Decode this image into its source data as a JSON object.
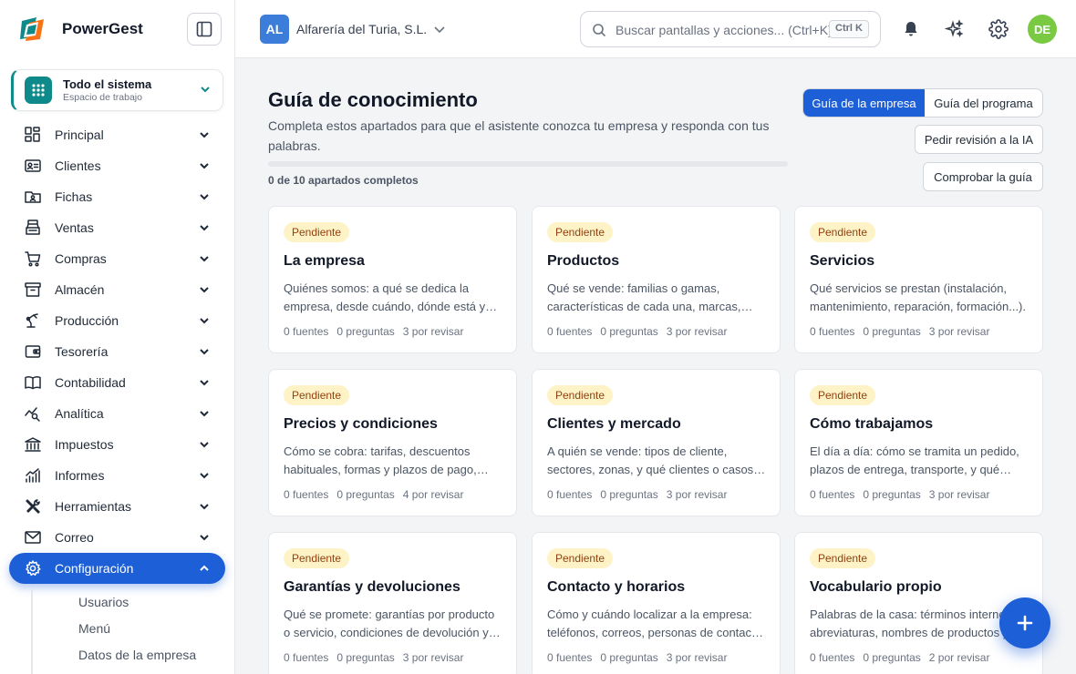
{
  "brand": {
    "name": "PowerGest",
    "accent": "#1d5fd6"
  },
  "workspace": {
    "title": "Todo el sistema",
    "subtitle": "Espacio de trabajo"
  },
  "nav": {
    "items": [
      {
        "label": "Principal",
        "icon": "grid-icon"
      },
      {
        "label": "Clientes",
        "icon": "id-card-icon"
      },
      {
        "label": "Fichas",
        "icon": "folder-user-icon"
      },
      {
        "label": "Ventas",
        "icon": "cash-register-icon"
      },
      {
        "label": "Compras",
        "icon": "cart-icon"
      },
      {
        "label": "Almacén",
        "icon": "archive-icon"
      },
      {
        "label": "Producción",
        "icon": "robot-arm-icon"
      },
      {
        "label": "Tesorería",
        "icon": "wallet-icon"
      },
      {
        "label": "Contabilidad",
        "icon": "book-icon"
      },
      {
        "label": "Analítica",
        "icon": "chart-search-icon"
      },
      {
        "label": "Impuestos",
        "icon": "bank-icon"
      },
      {
        "label": "Informes",
        "icon": "bars-icon"
      },
      {
        "label": "Herramientas",
        "icon": "tools-icon"
      },
      {
        "label": "Correo",
        "icon": "mail-icon"
      },
      {
        "label": "Configuración",
        "icon": "gear-icon",
        "active": true
      }
    ],
    "subitems": [
      "Usuarios",
      "Menú",
      "Datos de la empresa"
    ]
  },
  "header": {
    "company_initials": "AL",
    "company_name": "Alfarería del Turia, S.L.",
    "search_placeholder": "Buscar pantallas y acciones... (Ctrl+K)",
    "search_shortcut": "Ctrl K",
    "avatar_initials": "DE"
  },
  "main": {
    "title": "Guía de conocimiento",
    "subtitle": "Completa estos apartados para que el asistente conozca tu empresa y responda con tus palabras.",
    "progress": {
      "completed": 0,
      "total": 10,
      "label": "0 de 10 apartados completos"
    },
    "tabs": [
      {
        "label": "Guía de la empresa",
        "active": true
      },
      {
        "label": "Guía del programa",
        "active": false
      }
    ],
    "actions": {
      "review": "Pedir revisión a la IA",
      "check": "Comprobar la guía"
    },
    "cards": [
      {
        "status": "Pendiente",
        "title": "La empresa",
        "desc": "Quiénes somos: a qué se dedica la empresa, desde cuándo, dónde está y qué la hace distinta.",
        "sources": "0 fuentes",
        "questions": "0 preguntas",
        "review": "3 por revisar"
      },
      {
        "status": "Pendiente",
        "title": "Productos",
        "desc": "Qué se vende: familias o gamas, características de cada una, marcas, formatos.",
        "sources": "0 fuentes",
        "questions": "0 preguntas",
        "review": "3 por revisar"
      },
      {
        "status": "Pendiente",
        "title": "Servicios",
        "desc": "Qué servicios se prestan (instalación, mantenimiento, reparación, formación...).",
        "sources": "0 fuentes",
        "questions": "0 preguntas",
        "review": "3 por revisar"
      },
      {
        "status": "Pendiente",
        "title": "Precios y condiciones",
        "desc": "Cómo se cobra: tarifas, descuentos habituales, formas y plazos de pago, portes.",
        "sources": "0 fuentes",
        "questions": "0 preguntas",
        "review": "4 por revisar"
      },
      {
        "status": "Pendiente",
        "title": "Clientes y mercado",
        "desc": "A quién se vende: tipos de cliente, sectores, zonas, y qué clientes o casos son habituales.",
        "sources": "0 fuentes",
        "questions": "0 preguntas",
        "review": "3 por revisar"
      },
      {
        "status": "Pendiente",
        "title": "Cómo trabajamos",
        "desc": "El día a día: cómo se tramita un pedido, plazos de entrega, transporte, y qué pasos se siguen.",
        "sources": "0 fuentes",
        "questions": "0 preguntas",
        "review": "3 por revisar"
      },
      {
        "status": "Pendiente",
        "title": "Garantías y devoluciones",
        "desc": "Qué se promete: garantías por producto o servicio, condiciones de devolución y plazos.",
        "sources": "0 fuentes",
        "questions": "0 preguntas",
        "review": "3 por revisar"
      },
      {
        "status": "Pendiente",
        "title": "Contacto y horarios",
        "desc": "Cómo y cuándo localizar a la empresa: teléfonos, correos, personas de contacto y horarios.",
        "sources": "0 fuentes",
        "questions": "0 preguntas",
        "review": "3 por revisar"
      },
      {
        "status": "Pendiente",
        "title": "Vocabulario propio",
        "desc": "Palabras de la casa: términos internos, abreviaturas, nombres de productos y su significado.",
        "sources": "0 fuentes",
        "questions": "0 preguntas",
        "review": "2 por revisar"
      }
    ]
  }
}
